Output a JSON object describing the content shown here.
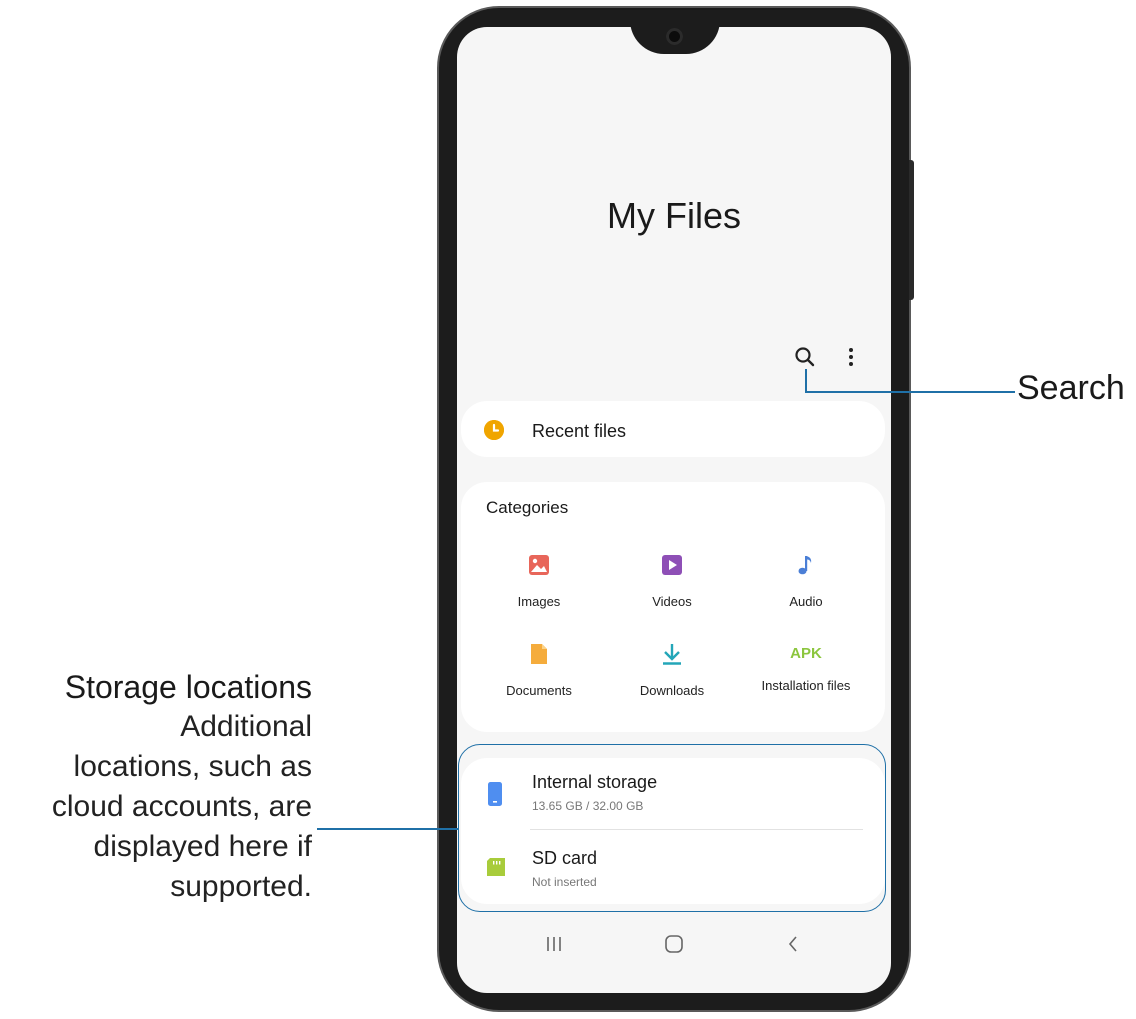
{
  "app": {
    "title": "My Files",
    "toolbar": {
      "search_icon": "search-icon",
      "more_icon": "more-options-icon"
    },
    "recent": {
      "label": "Recent files",
      "icon": "clock-icon",
      "color": "#f0a500"
    },
    "categories": {
      "heading": "Categories",
      "items": [
        {
          "label": "Images",
          "icon": "image-icon",
          "color": "#e8665a"
        },
        {
          "label": "Videos",
          "icon": "video-icon",
          "color": "#8e4fb6"
        },
        {
          "label": "Audio",
          "icon": "music-note-icon",
          "color": "#4b7fd6"
        },
        {
          "label": "Documents",
          "icon": "document-icon",
          "color": "#f5ac3c"
        },
        {
          "label": "Downloads",
          "icon": "download-icon",
          "color": "#23a6b8"
        },
        {
          "label": "Installation files",
          "icon": "apk-icon",
          "icon_text": "APK",
          "color": "#8cc63e"
        }
      ]
    },
    "storage": [
      {
        "label": "Internal storage",
        "detail": "13.65 GB / 32.00 GB",
        "icon": "phone-storage-icon",
        "color": "#4f8ef0"
      },
      {
        "label": "SD card",
        "detail": "Not inserted",
        "icon": "sd-card-icon",
        "color": "#a8cc3b"
      }
    ],
    "nav_bar": {
      "recents_icon": "recent-apps-icon",
      "home_icon": "home-icon",
      "back_icon": "back-icon"
    }
  },
  "callouts": {
    "search": "Search",
    "storage": {
      "heading": "Storage locations",
      "lines": [
        "Additional",
        "locations, such as",
        "cloud accounts, are",
        "displayed here if",
        "supported."
      ]
    }
  },
  "accent_color": "#1f70a7"
}
